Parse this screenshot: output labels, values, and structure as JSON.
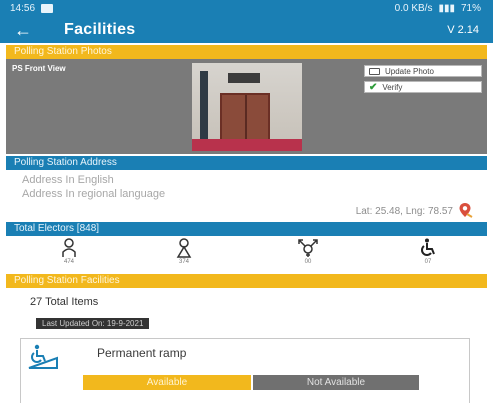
{
  "status_bar": {
    "time": "14:56",
    "network": "0.0 KB/s",
    "battery": "71%"
  },
  "app_bar": {
    "back_glyph": "←",
    "title": "Facilities",
    "version": "V 2.14"
  },
  "photos_section": {
    "header": "Polling Station Photos",
    "photo_label": "PS Front View",
    "update_photo": "Update Photo",
    "verify": "Verify"
  },
  "address_section": {
    "header": "Polling Station Address",
    "address_english": "Address In English",
    "address_regional": "Address In regional language",
    "coordinates": "Lat: 25.48, Lng: 78.57"
  },
  "electors": {
    "header": "Total Electors [848]",
    "items": [
      {
        "name": "male",
        "icon": "male-person-icon",
        "count": "474"
      },
      {
        "name": "female",
        "icon": "female-person-icon",
        "count": "374"
      },
      {
        "name": "third-gender",
        "icon": "third-gender-icon",
        "count": "00"
      },
      {
        "name": "pwd",
        "icon": "wheelchair-icon",
        "count": "07"
      }
    ]
  },
  "facilities_section": {
    "header": "Polling Station Facilities",
    "total_items": "27 Total Items",
    "last_updated": "Last Updated On: 19-9-2021",
    "facility": {
      "label": "Permanent ramp",
      "icon": "ramp-wheelchair-icon",
      "available": "Available",
      "not_available": "Not Available"
    }
  },
  "colors": {
    "primary": "#1a7fb4",
    "accent": "#f2b81d",
    "grey_button": "#707070"
  }
}
